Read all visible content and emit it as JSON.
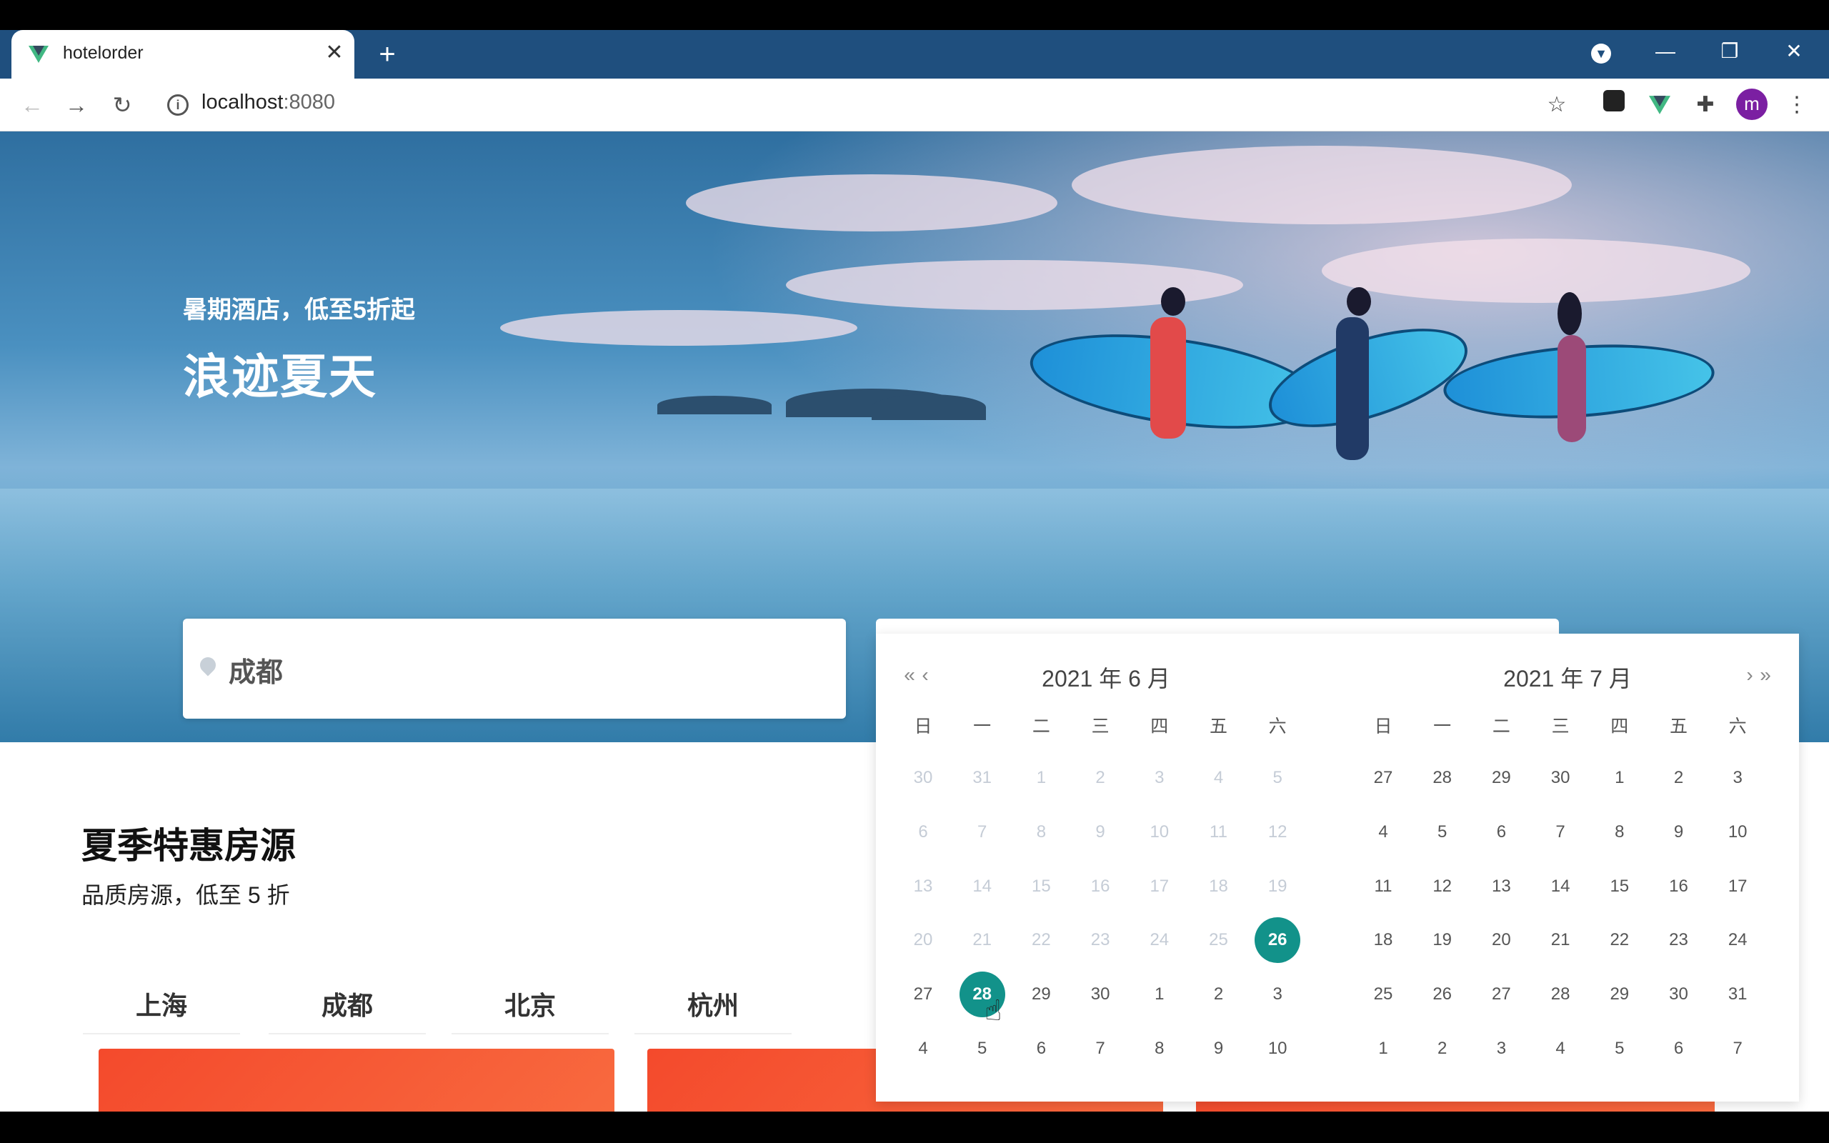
{
  "browser": {
    "tab_title": "hotelorder",
    "tab_close": "✕",
    "new_tab": "+",
    "url_host": "localhost",
    "url_port": ":8080",
    "profile_initial": "m"
  },
  "hero": {
    "subtitle": "暑期酒店，低至5折起",
    "title": "浪迹夏天"
  },
  "search": {
    "city": "成都"
  },
  "section": {
    "title": "夏季特惠房源",
    "subtitle": "品质房源，低至 5 折",
    "tabs": [
      "上海",
      "成都",
      "北京",
      "杭州"
    ]
  },
  "calendar": {
    "left_title": "2021 年 6 月",
    "right_title": "2021 年 7 月",
    "weekdays": [
      "日",
      "一",
      "二",
      "三",
      "四",
      "五",
      "六"
    ],
    "left_days": [
      [
        [
          "30",
          1
        ],
        [
          "31",
          1
        ],
        [
          "1",
          1
        ],
        [
          "2",
          1
        ],
        [
          "3",
          1
        ],
        [
          "4",
          1
        ],
        [
          "5",
          1
        ]
      ],
      [
        [
          "6",
          1
        ],
        [
          "7",
          1
        ],
        [
          "8",
          1
        ],
        [
          "9",
          1
        ],
        [
          "10",
          1
        ],
        [
          "11",
          1
        ],
        [
          "12",
          1
        ]
      ],
      [
        [
          "13",
          1
        ],
        [
          "14",
          1
        ],
        [
          "15",
          1
        ],
        [
          "16",
          1
        ],
        [
          "17",
          1
        ],
        [
          "18",
          1
        ],
        [
          "19",
          1
        ]
      ],
      [
        [
          "20",
          1
        ],
        [
          "21",
          1
        ],
        [
          "22",
          1
        ],
        [
          "23",
          1
        ],
        [
          "24",
          1
        ],
        [
          "25",
          1
        ],
        [
          "26",
          2
        ]
      ],
      [
        [
          "27",
          0
        ],
        [
          "28",
          2
        ],
        [
          "29",
          0
        ],
        [
          "30",
          0
        ],
        [
          "1",
          0
        ],
        [
          "2",
          0
        ],
        [
          "3",
          0
        ]
      ],
      [
        [
          "4",
          0
        ],
        [
          "5",
          0
        ],
        [
          "6",
          0
        ],
        [
          "7",
          0
        ],
        [
          "8",
          0
        ],
        [
          "9",
          0
        ],
        [
          "10",
          0
        ]
      ]
    ],
    "right_days": [
      [
        "27",
        "28",
        "29",
        "30",
        "1",
        "2",
        "3"
      ],
      [
        "4",
        "5",
        "6",
        "7",
        "8",
        "9",
        "10"
      ],
      [
        "11",
        "12",
        "13",
        "14",
        "15",
        "16",
        "17"
      ],
      [
        "18",
        "19",
        "20",
        "21",
        "22",
        "23",
        "24"
      ],
      [
        "25",
        "26",
        "27",
        "28",
        "29",
        "30",
        "31"
      ],
      [
        "1",
        "2",
        "3",
        "4",
        "5",
        "6",
        "7"
      ]
    ],
    "selected_color": "#12928a"
  }
}
